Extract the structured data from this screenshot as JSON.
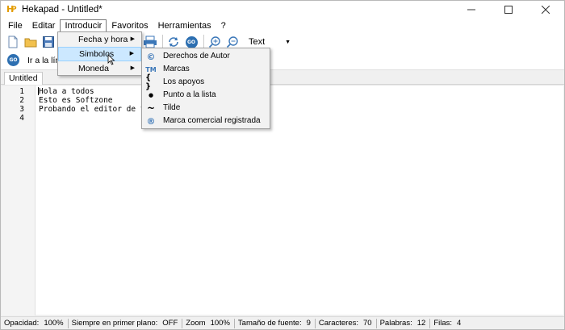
{
  "window": {
    "title": "Hekapad - Untitled*"
  },
  "menu": [
    "File",
    "Editar",
    "Introducir",
    "Favoritos",
    "Herramientas",
    "?"
  ],
  "toolbar": {
    "format_value": "Text"
  },
  "goto": {
    "label": "Ir a la línea",
    "badge": "GO"
  },
  "tab": {
    "label": "Untitled"
  },
  "editor": {
    "line_numbers": [
      "1",
      "2",
      "3",
      "4"
    ],
    "lines": [
      "Hola a todos",
      "Esto es Softzone",
      "Probando el editor de textos H",
      ""
    ]
  },
  "introducir_menu": {
    "items": [
      {
        "label": "Fecha y hora"
      },
      {
        "label": "Simbolos"
      },
      {
        "label": "Moneda"
      }
    ]
  },
  "simbolos_menu": {
    "items": [
      {
        "icon": "copyright-icon",
        "glyph": "©",
        "label": "Derechos de Autor"
      },
      {
        "icon": "trademark-icon",
        "glyph": "TM",
        "label": "Marcas"
      },
      {
        "icon": "braces-icon",
        "glyph": "{ }",
        "label": "Los apoyos"
      },
      {
        "icon": "bullet-icon",
        "glyph": "●",
        "label": "Punto a la lista"
      },
      {
        "icon": "tilde-icon",
        "glyph": "~",
        "label": "Tilde"
      },
      {
        "icon": "registered-icon",
        "glyph": "®",
        "label": "Marca comercial registrada"
      }
    ]
  },
  "status": [
    {
      "label": "Opacidad:",
      "value": "100%"
    },
    {
      "label": "Siempre en primer plano:",
      "value": "OFF"
    },
    {
      "label": "Zoom",
      "value": "100%"
    },
    {
      "label": "Tamaño de fuente:",
      "value": "9"
    },
    {
      "label": "Caracteres:",
      "value": "70"
    },
    {
      "label": "Palabras:",
      "value": "12"
    },
    {
      "label": "Filas:",
      "value": "4"
    }
  ],
  "colors": {
    "accent": "#2d6fb1",
    "highlight": "#cce8ff",
    "app_icon": "#e39b00",
    "icon_blue": "#3b77b8"
  }
}
